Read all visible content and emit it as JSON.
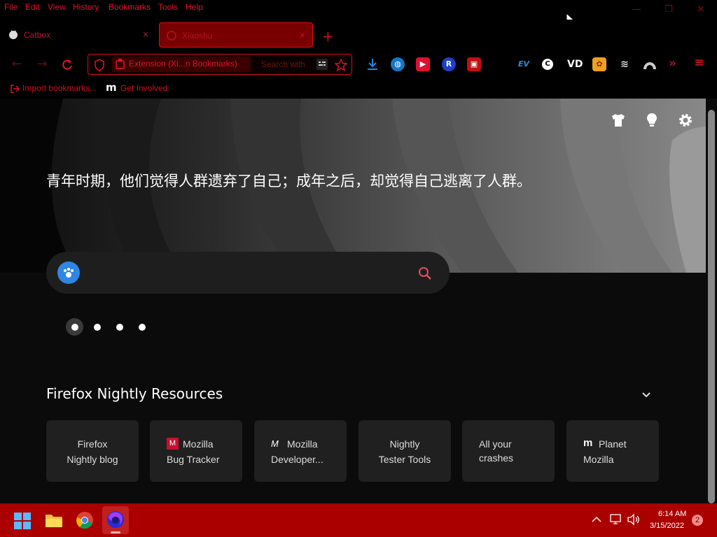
{
  "menu": {
    "file": "File",
    "edit": "Edit",
    "view": "View",
    "history": "History",
    "bookmarks": "Bookmarks",
    "tools": "Tools",
    "help": "Help"
  },
  "window": {
    "minimize": "—",
    "restore": "❐",
    "close": "✕"
  },
  "tabs": [
    {
      "label": "Catbox"
    },
    {
      "label": "Xiaoshu"
    }
  ],
  "tab_close": "×",
  "new_tab": "+",
  "urlbar": {
    "value": "Extension (Xi...n Bookmarks)",
    "placeholder": "Search with"
  },
  "bookmarks": [
    {
      "label": "Import bookmarks..."
    },
    {
      "label": "Get Involved"
    }
  ],
  "hero": {
    "quote": "青年时期，他们觉得人群遗弃了自己；成年之后，却觉得自己逃离了人群。"
  },
  "resources": {
    "title": "Firefox Nightly Resources",
    "cards": [
      {
        "line1": "Firefox",
        "line2": "Nightly blog"
      },
      {
        "line1": "Mozilla",
        "line2": "Bug Tracker"
      },
      {
        "line1": "Mozilla",
        "line2": "Developer..."
      },
      {
        "line1": "Nightly",
        "line2": "Tester Tools"
      },
      {
        "line1": "All your",
        "line2": "crashes"
      },
      {
        "line1": "Planet",
        "line2": "Mozilla"
      }
    ]
  },
  "taskbar": {
    "time": "6:14 AM",
    "date": "3/15/2022",
    "notifications": "2"
  },
  "colors": {
    "accent": "#e0142a",
    "taskbar": "#aa0000",
    "search_paw": "#2f86e5"
  }
}
